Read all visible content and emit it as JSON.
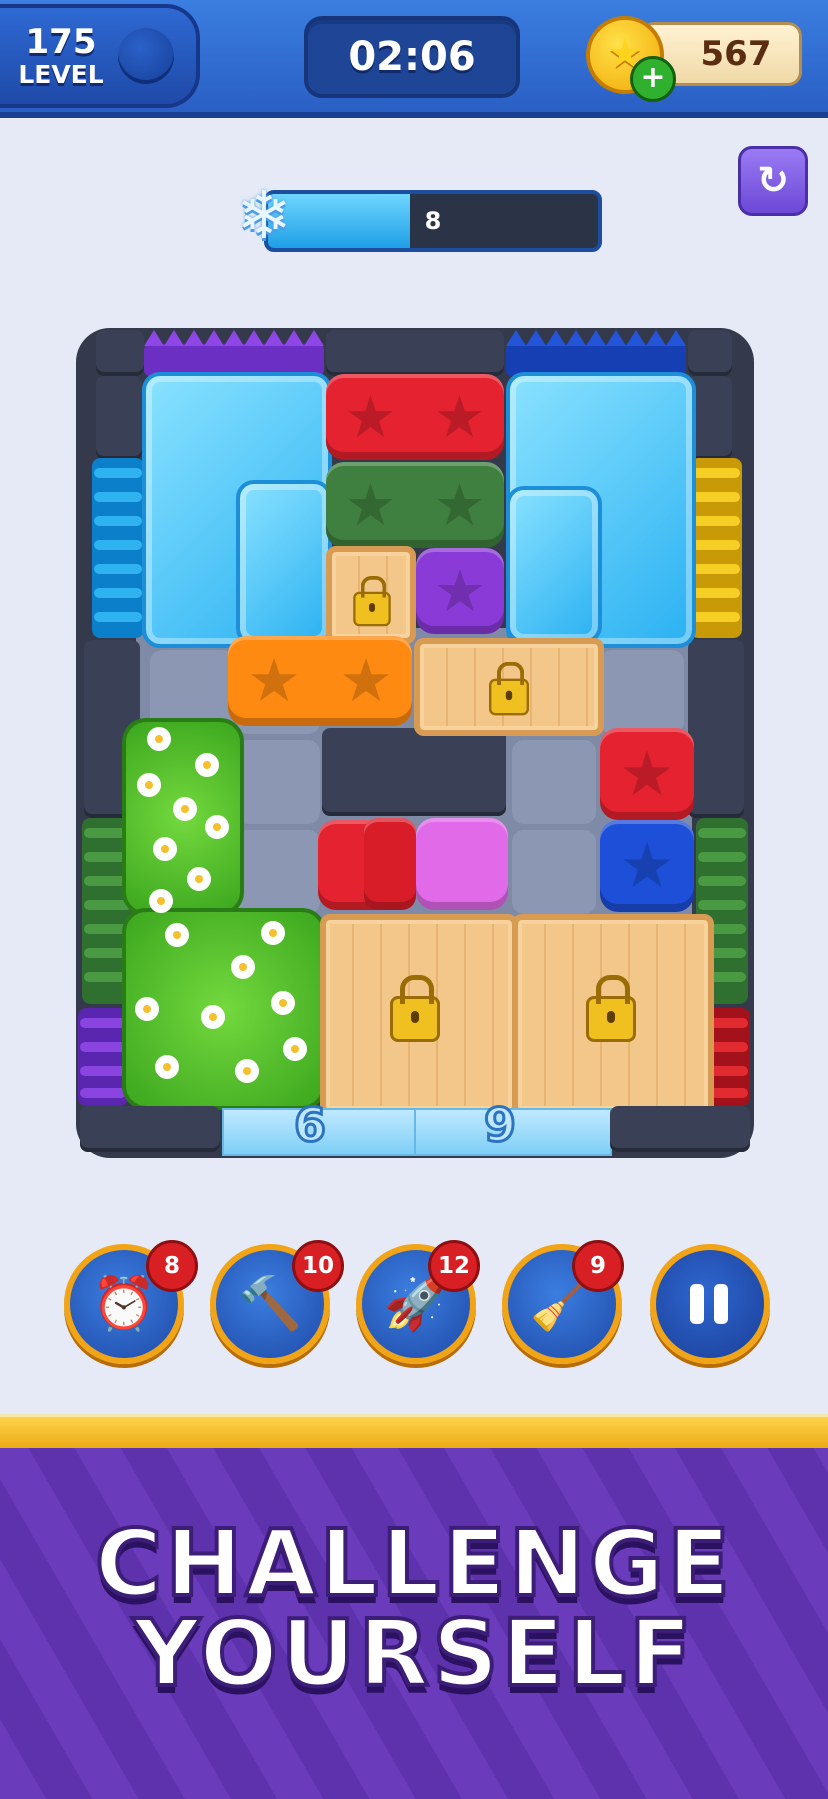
{
  "header": {
    "level_number": "175",
    "level_label": "LEVEL",
    "timer": "02:06",
    "coins": "567",
    "coin_icon": "star-coin-icon",
    "add_coins_icon": "plus-icon"
  },
  "freeze": {
    "icon": "snowflake-icon",
    "value": "8",
    "fill_fraction": 0.43
  },
  "restart_icon": "restart-icon",
  "board": {
    "exits": [
      {
        "label": "6",
        "color": "#bfe7ff"
      },
      {
        "label": "9",
        "color": "#bfe7ff"
      }
    ],
    "block_colors": {
      "red": "#e5222f",
      "green": "#3f7f3f",
      "purple": "#8a3ad6",
      "orange": "#ff8a12",
      "blue": "#1d4fd8",
      "pink": "#e06ae8",
      "ice": "#2bb1f2",
      "crate": "#f3c68a"
    }
  },
  "boosters": [
    {
      "name": "alarm-clock",
      "icon": "alarm-clock-icon",
      "glyph": "⏰",
      "count": "8"
    },
    {
      "name": "hammer",
      "icon": "hammer-icon",
      "glyph": "🔨",
      "count": "10"
    },
    {
      "name": "rocket",
      "icon": "firework-rocket-icon",
      "glyph": "🚀",
      "count": "12"
    },
    {
      "name": "vacuum",
      "icon": "vacuum-cleaner-icon",
      "glyph": "🧹",
      "count": "9"
    }
  ],
  "pause_icon": "pause-icon",
  "banner": {
    "line1": "CHALLENGE",
    "line2": "YOURSELF"
  }
}
